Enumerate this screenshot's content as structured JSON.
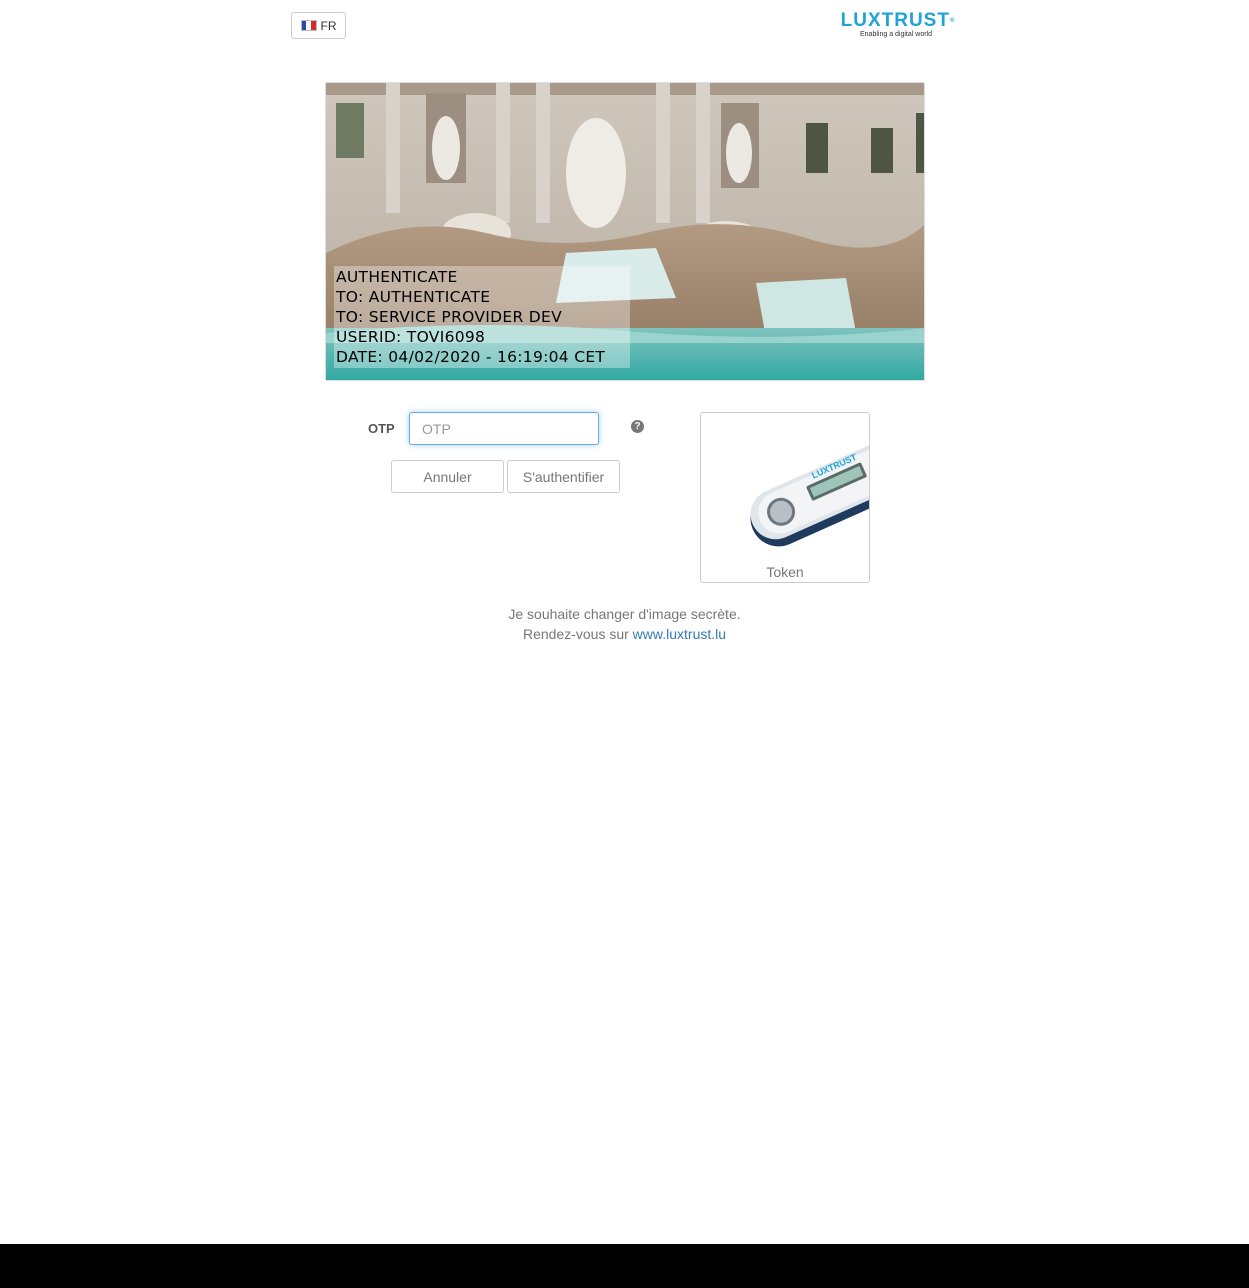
{
  "header": {
    "language": "FR",
    "logo": {
      "name": "LUXTRUST",
      "tagline": "Enabling a digital world",
      "color": "#1fa3d6"
    }
  },
  "secret_image": {
    "lines": [
      "AUTHENTICATE",
      "TO: AUTHENTICATE",
      "TO: SERVICE PROVIDER DEV",
      "USERID: TOVI6098",
      "DATE: 04/02/2020 - 16:19:04 CET"
    ]
  },
  "form": {
    "otp_label": "OTP",
    "otp_placeholder": "OTP",
    "otp_value": "",
    "help_icon": "question-circle-icon",
    "cancel_label": "Annuler",
    "submit_label": "S'authentifier"
  },
  "device": {
    "caption": "Token",
    "brand": "LUXTRUST"
  },
  "footer": {
    "line1": "Je souhaite changer d'image secrète.",
    "line2_prefix": "Rendez-vous sur",
    "link": "www.luxtrust.lu"
  },
  "colors": {
    "accent": "#1fa3d6",
    "link": "#337ab7",
    "focus": "#66afe9"
  }
}
